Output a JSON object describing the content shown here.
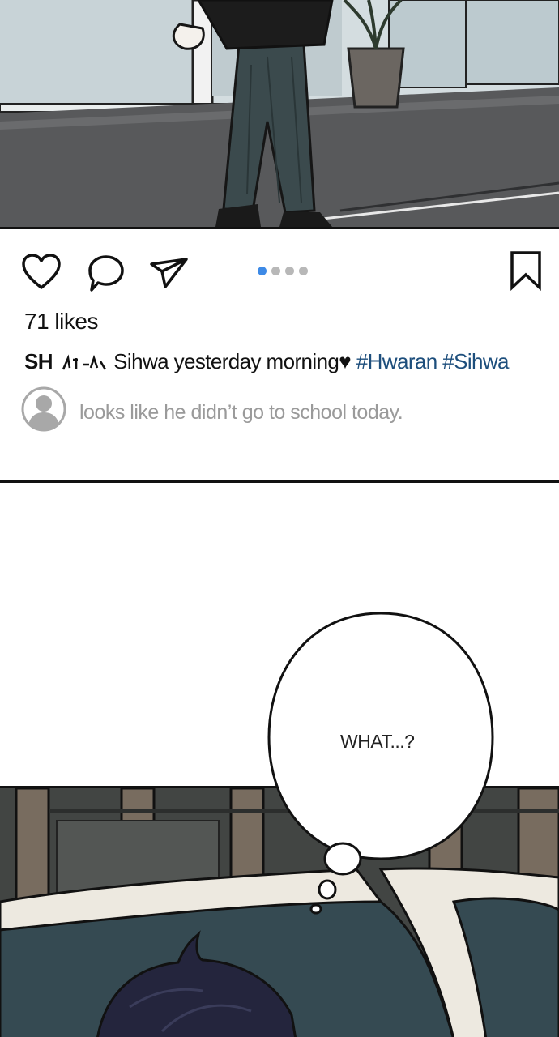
{
  "post": {
    "likes_text": "71 likes",
    "username": "SH",
    "caption_text": "Sihwa yesterday morning",
    "caption_heart": "♥",
    "hashtags": "#Hwaran #Sihwa",
    "comment_text": "looks like he didn’t go to school today.",
    "carousel": {
      "total": 4,
      "active_index": 0
    },
    "colors": {
      "hashtag": "#1d4e7c",
      "active_dot": "#3d8ae6",
      "comment": "#9a9a9a"
    }
  },
  "bubble": {
    "text": "WHAT...?"
  },
  "icons": [
    "heart-icon",
    "comment-icon",
    "send-icon",
    "bookmark-icon",
    "avatar-icon"
  ]
}
